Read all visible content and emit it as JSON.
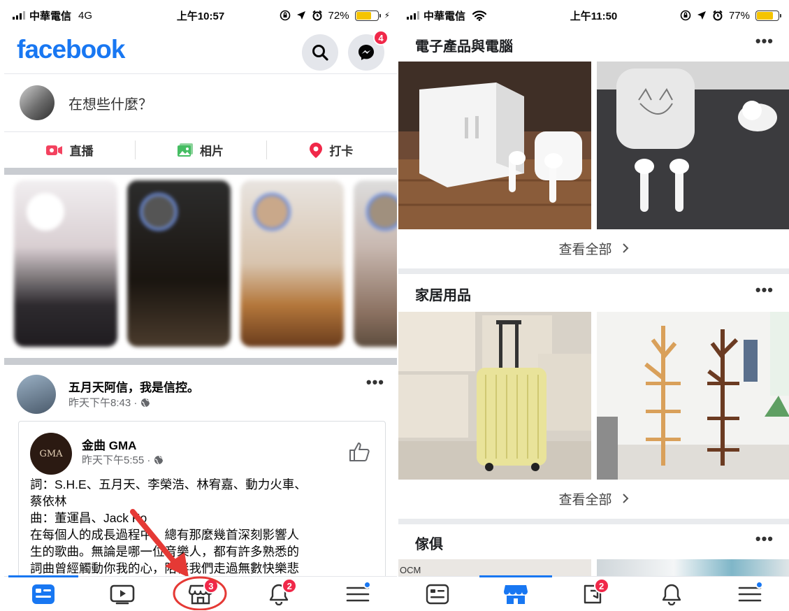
{
  "left_phone": {
    "status": {
      "carrier": "中華電信",
      "network": "4G",
      "time": "上午10:57",
      "battery": "72%",
      "battery_level": 0.72
    },
    "header": {
      "logo": "facebook",
      "search_icon": "search-icon",
      "messenger_icon": "messenger-icon",
      "messenger_badge": "4"
    },
    "composer": {
      "placeholder": "在想些什麼？"
    },
    "actions": [
      {
        "label": "直播",
        "icon": "live-video-icon",
        "color": "#f3425f"
      },
      {
        "label": "相片",
        "icon": "photo-icon",
        "color": "#45bd62"
      },
      {
        "label": "打卡",
        "icon": "check-in-icon",
        "color": "#f02849"
      }
    ],
    "post": {
      "author": "五月天阿信，我是信控。",
      "time": "昨天下午8:43 · ",
      "shared": {
        "logo_text": "GMA",
        "author": "金曲 GMA",
        "time": "昨天下午5:55 · ",
        "lines": [
          "詞：S.H.E、五月天、李榮浩、林宥嘉、動力火車、",
          "蔡依林",
          "曲：董運昌、Jack Ko",
          "在每個人的成長過程中，總有那麼幾首深刻影響人",
          "生的歌曲。無論是哪一位音樂人，都有許多熟悉的",
          "詞曲曾經觸動你我的心，陪伴我們走過無數快樂悲"
        ]
      }
    },
    "tabbar": [
      {
        "icon": "home-feed-icon",
        "badge": "",
        "active": true
      },
      {
        "icon": "watch-video-icon",
        "badge": "",
        "active": false
      },
      {
        "icon": "marketplace-icon",
        "badge": "3",
        "active": false
      },
      {
        "icon": "bell-icon",
        "badge": "2",
        "active": false
      },
      {
        "icon": "menu-icon",
        "badge": "",
        "active": false
      }
    ]
  },
  "right_phone": {
    "status": {
      "carrier": "中華電信",
      "time": "上午11:50",
      "battery": "77%",
      "battery_level": 0.77
    },
    "sections": [
      {
        "title": "電子產品與電腦",
        "see_all": "查看全部"
      },
      {
        "title": "家居用品",
        "see_all": "查看全部"
      },
      {
        "title": "傢俱",
        "see_all": "",
        "tile_text": "OCM"
      }
    ],
    "tabbar": [
      {
        "icon": "home-feed-icon",
        "badge": "",
        "active": false
      },
      {
        "icon": "marketplace-icon",
        "badge": "",
        "active": true
      },
      {
        "icon": "pages-icon",
        "badge": "2",
        "active": false
      },
      {
        "icon": "bell-icon",
        "badge": "",
        "active": false
      },
      {
        "icon": "menu-icon",
        "badge": "",
        "active": false
      }
    ]
  },
  "colors": {
    "brand": "#1877f2",
    "badge": "#f02849",
    "annotation": "#e53935"
  }
}
